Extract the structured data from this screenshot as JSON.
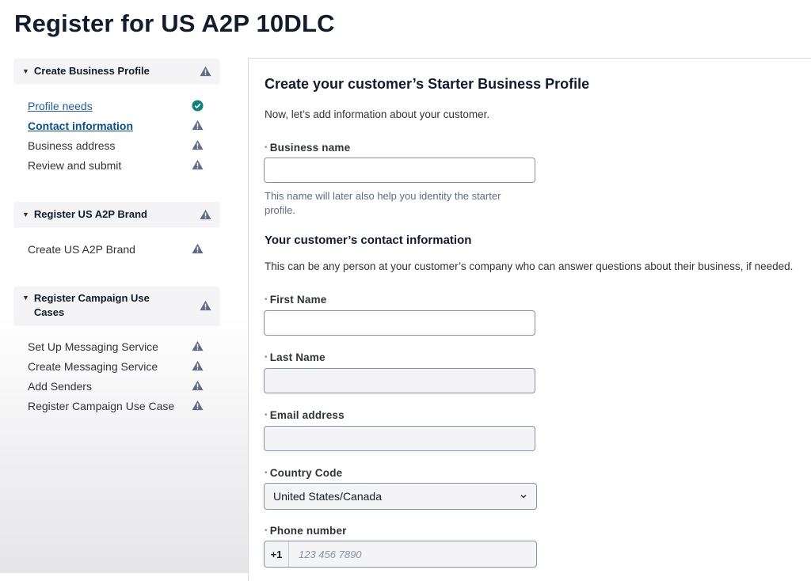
{
  "page": {
    "title": "Register for US A2P 10DLC"
  },
  "sidebar": {
    "sections": [
      {
        "label": "Create Business Profile",
        "status": "warning",
        "steps": [
          {
            "label": "Profile needs",
            "status": "complete"
          },
          {
            "label": "Contact information",
            "status": "warning"
          },
          {
            "label": "Business address",
            "status": "warning"
          },
          {
            "label": "Review and submit",
            "status": "warning"
          }
        ]
      },
      {
        "label": "Register US A2P Brand",
        "status": "warning",
        "steps": [
          {
            "label": "Create US A2P Brand",
            "status": "warning"
          }
        ]
      },
      {
        "label": "Register Campaign Use Cases",
        "status": "warning",
        "steps": [
          {
            "label": "Set Up Messaging Service",
            "status": "warning"
          },
          {
            "label": "Create Messaging Service",
            "status": "warning"
          },
          {
            "label": "Add Senders",
            "status": "warning"
          },
          {
            "label": "Register Campaign Use Case",
            "status": "warning"
          }
        ]
      }
    ]
  },
  "form": {
    "title": "Create your customer’s Starter Business Profile",
    "intro": "Now, let’s add information about your customer.",
    "business_name": {
      "label": "Business name",
      "value": "",
      "help": "This name will later also help you identity the starter profile."
    },
    "contact_section": {
      "title": "Your customer’s contact information",
      "description": "This can be any person at your customer’s company who can answer questions about their business, if needed."
    },
    "first_name": {
      "label": "First Name",
      "value": ""
    },
    "last_name": {
      "label": "Last Name",
      "value": ""
    },
    "email": {
      "label": "Email address",
      "value": ""
    },
    "country_code": {
      "label": "Country Code",
      "value": "United States/Canada"
    },
    "phone": {
      "label": "Phone number",
      "prefix": "+1",
      "placeholder": "123 456 7890"
    },
    "required_marker": "•"
  },
  "colors": {
    "warning_icon": "#606b85",
    "complete_icon": "#14807a",
    "link": "#1f5f9a"
  },
  "icons": {
    "warning": "warning-triangle-icon",
    "complete": "check-circle-icon",
    "caret": "caret-down-icon",
    "select": "chevron-down-icon"
  }
}
